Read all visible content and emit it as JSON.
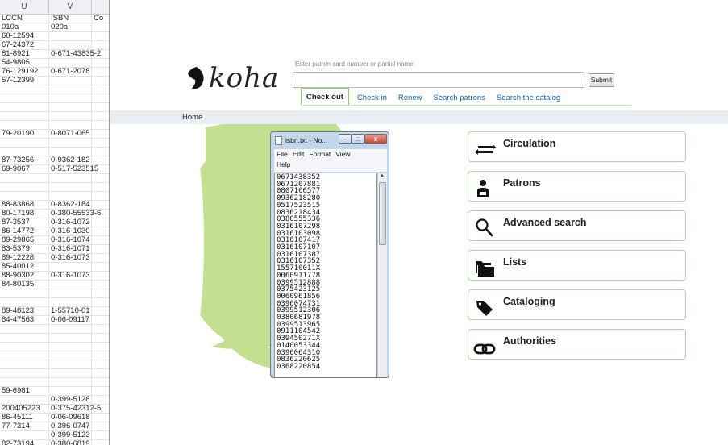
{
  "spreadsheet": {
    "columns": [
      "U",
      "V",
      ""
    ],
    "rows": [
      [
        "LCCN",
        "ISBN",
        "Co"
      ],
      [
        "010a",
        "020a",
        ""
      ],
      [
        "60-12594",
        "",
        ""
      ],
      [
        "67-24372",
        "",
        ""
      ],
      [
        "81-8921",
        "0-671-43835-2",
        ""
      ],
      [
        "54-9805",
        "",
        ""
      ],
      [
        "76-129192",
        "0-671-2078",
        ""
      ],
      [
        "57-12399",
        "",
        ""
      ],
      [
        "",
        "",
        ""
      ],
      [
        "",
        "",
        ""
      ],
      [
        "",
        "",
        ""
      ],
      [
        "",
        "",
        ""
      ],
      [
        "",
        "",
        ""
      ],
      [
        "79-20190",
        "0-8071-065",
        ""
      ],
      [
        "",
        "",
        ""
      ],
      [
        "",
        "",
        ""
      ],
      [
        "87-73256",
        "0-9362-182",
        ""
      ],
      [
        "69-9067",
        "0-517-523515",
        ""
      ],
      [
        "",
        "",
        ""
      ],
      [
        "",
        "",
        ""
      ],
      [
        "",
        "",
        ""
      ],
      [
        "88-83868",
        "0-8362-184",
        ""
      ],
      [
        "80-17198",
        "0-380-55533-6",
        ""
      ],
      [
        "87-3537",
        "0-316-1072",
        ""
      ],
      [
        "86-14772",
        "0-316-1030",
        ""
      ],
      [
        "89-29865",
        "0-316-1074",
        ""
      ],
      [
        "83-5379",
        "0-316-1071",
        ""
      ],
      [
        "89-12228",
        "0-316-1073",
        ""
      ],
      [
        "85-40012",
        "",
        ""
      ],
      [
        "88-90302",
        "0-316-1073",
        ""
      ],
      [
        "84-80135",
        "",
        ""
      ],
      [
        "",
        "",
        ""
      ],
      [
        "",
        "",
        ""
      ],
      [
        "89-48123",
        "1-55710-01",
        ""
      ],
      [
        "84-47563",
        "0-06-09117",
        ""
      ],
      [
        "",
        "",
        ""
      ],
      [
        "",
        "",
        ""
      ],
      [
        "",
        "",
        ""
      ],
      [
        "",
        "",
        ""
      ],
      [
        "",
        "",
        ""
      ],
      [
        "",
        "",
        ""
      ],
      [
        "",
        "",
        ""
      ],
      [
        "59-6981",
        "",
        ""
      ],
      [
        "",
        "0-399-5128",
        ""
      ],
      [
        "200405223",
        "0-375-42312-5",
        ""
      ],
      [
        "86-45111",
        "0-06-09618",
        ""
      ],
      [
        "77-7314",
        "0-396-0747",
        ""
      ],
      [
        "",
        "0-399-5123",
        ""
      ],
      [
        "82-73194",
        "0-380-6819",
        ""
      ]
    ]
  },
  "koha": {
    "logo_text": "koha",
    "search_label": "Enter patron card number or partial name:",
    "search_value": "",
    "submit_label": "Submit",
    "tabs": [
      "Check out",
      "Check in",
      "Renew",
      "Search patrons",
      "Search the catalog"
    ],
    "active_tab": "Check out",
    "breadcrumb": "Home",
    "blob_color": "#c2e08f",
    "accent_color": "#8fcf5a",
    "nav": [
      {
        "label": "Circulation",
        "icon": "arrows-exchange-icon"
      },
      {
        "label": "Patrons",
        "icon": "person-icon"
      },
      {
        "label": "Advanced search",
        "icon": "magnifier-icon"
      },
      {
        "label": "Lists",
        "icon": "folders-icon"
      },
      {
        "label": "Cataloging",
        "icon": "tag-icon"
      },
      {
        "label": "Authorities",
        "icon": "link-icon"
      }
    ]
  },
  "notepad": {
    "title": "isbn.txt - No...",
    "menu": [
      "File",
      "Edit",
      "Format",
      "View",
      "Help"
    ],
    "lines": [
      "0671438352",
      "0671207881",
      "0807106577",
      "0936218280",
      "0517523515",
      "0836218434",
      "0380555336",
      "0316107298",
      "0316103098",
      "0316107417",
      "0316107107",
      "0316107387",
      "0316107352",
      "155710011X",
      "0060911778",
      "0399512888",
      "0375423125",
      "0060961856",
      "0396074731",
      "0399512306",
      "0380681978",
      "0399513965",
      "0911104542",
      "039450271X",
      "0140053344",
      "0396064310",
      "0836220625",
      "0368220854"
    ]
  }
}
